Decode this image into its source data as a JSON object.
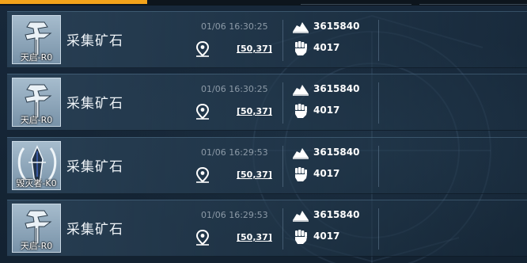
{
  "rows": [
    {
      "ship_name": "天启-R0",
      "ship_icon": "tianqi-ship-icon",
      "action": "采集矿石",
      "time": "01/06 16:30:25",
      "coords": "[50,37]",
      "resource": "3615840",
      "power": "4017"
    },
    {
      "ship_name": "天启-R0",
      "ship_icon": "tianqi-ship-icon",
      "action": "采集矿石",
      "time": "01/06 16:30:25",
      "coords": "[50,37]",
      "resource": "3615840",
      "power": "4017"
    },
    {
      "ship_name": "毁灭者-K0",
      "ship_icon": "destroyer-ship-icon",
      "action": "采集矿石",
      "time": "01/06 16:29:53",
      "coords": "[50,37]",
      "resource": "3615840",
      "power": "4017"
    },
    {
      "ship_name": "天启-R0",
      "ship_icon": "tianqi-ship-icon",
      "action": "采集矿石",
      "time": "01/06 16:29:53",
      "coords": "[50,37]",
      "resource": "3615840",
      "power": "4017"
    }
  ],
  "colors": {
    "accent": "#f2a31b",
    "background": "#152331",
    "row_background": "#2d465c",
    "muted_text": "#8c9aa7",
    "text": "#ffffff"
  }
}
